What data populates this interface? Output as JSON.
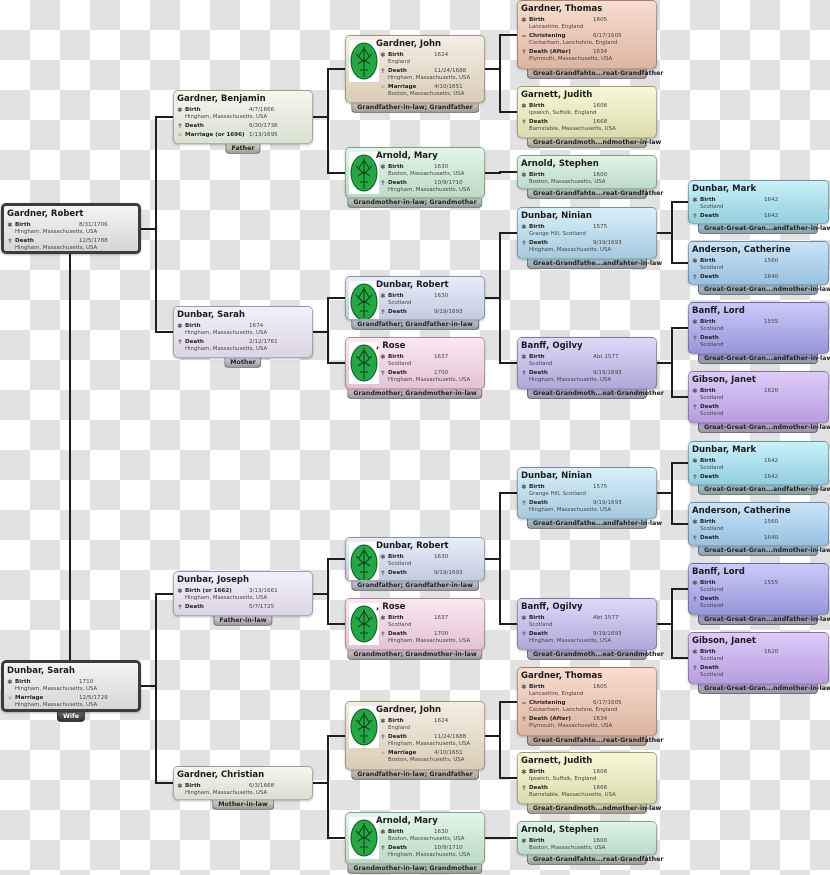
{
  "people": [
    {
      "name": "Gardner, Robert",
      "color": "#f4f4f4",
      "color2": "#d6d6d6",
      "relation": "",
      "events": [
        {
          "label": "Birth",
          "date": "8/31/1706",
          "place": "Hingham, Massachusetts, USA"
        },
        {
          "label": "Death",
          "date": "12/5/1788",
          "place": "Hingham, Massachusetts, USA"
        }
      ]
    },
    {
      "name": "Dunbar, Sarah",
      "color": "#f4f4f4",
      "color2": "#d6d6d6",
      "relation": "Wife",
      "events": [
        {
          "label": "Birth",
          "date": "1710",
          "place": "Hingham, Massachusetts, USA"
        },
        {
          "label": "Marriage",
          "date": "12/5/1729",
          "place": "Hingham, Massachusetts, USA"
        }
      ]
    },
    {
      "name": "Gardner, Benjamin",
      "color": "#f4f6ee",
      "color2": "#dbe1d0",
      "relation": "Father",
      "events": [
        {
          "label": "Birth",
          "date": "4/7/1666",
          "place": "Hingham, Massachusetts, USA"
        },
        {
          "label": "Death",
          "date": "6/30/1736",
          "place": ""
        },
        {
          "label": "Marriage (or 1696)",
          "date": "1/13/1695",
          "place": ""
        }
      ]
    },
    {
      "name": "Dunbar, Sarah",
      "color": "#f3effa",
      "color2": "#dcd5e6",
      "relation": "Mother",
      "events": [
        {
          "label": "Birth",
          "date": "1674",
          "place": "Hingham, Massachusetts, USA"
        },
        {
          "label": "Death",
          "date": "2/12/1761",
          "place": "Hingham, Massachusetts, USA"
        }
      ]
    },
    {
      "name": "Gardner, John",
      "photo": true,
      "color": "#f5eee2",
      "color2": "#dacdb8",
      "relation": "Grandfather-in-law; Grandfather",
      "events": [
        {
          "label": "Birth",
          "date": "1624",
          "place": "England"
        },
        {
          "label": "Death",
          "date": "11/24/1688",
          "place": "Hingham, Massachusetts, USA"
        },
        {
          "label": "Marriage",
          "date": "4/10/1651",
          "place": "Boston, Massachusetts, USA"
        }
      ]
    },
    {
      "name": "Arnold, Mary",
      "photo": true,
      "color": "#e3f6e8",
      "color2": "#bcdbc5",
      "relation": "Grandmother-in-law; Grandmother",
      "events": [
        {
          "label": "Birth",
          "date": "1630",
          "place": "Boston, Massachusetts, USA"
        },
        {
          "label": "Death",
          "date": "10/9/1710",
          "place": "Hingham, Massachusetts, USA"
        }
      ]
    },
    {
      "name": "Dunbar, Robert",
      "photo": true,
      "color": "#e8edf9",
      "color2": "#c3cbe0",
      "relation": "Grandfather; Grandfather-in-law",
      "events": [
        {
          "label": "Birth",
          "date": "1630",
          "place": "Scotland"
        },
        {
          "label": "Death",
          "date": "9/19/1693",
          "place": ""
        }
      ]
    },
    {
      "name": ", Rose",
      "photo": true,
      "color": "#fce8f3",
      "color2": "#e3c3d5",
      "relation": "Grandmother; Grandmother-in-law",
      "events": [
        {
          "label": "Birth",
          "date": "1637",
          "place": "Scotland"
        },
        {
          "label": "Death",
          "date": "1700",
          "place": "Hingham, Massachusetts, USA"
        }
      ]
    },
    {
      "name": "Gardner, Thomas",
      "color": "#f8ddd0",
      "color2": "#ddb5a2",
      "relation": "Great-Grandfahte...reat-Grandfather",
      "events": [
        {
          "label": "Birth",
          "date": "1605",
          "place": "Lancashire, England"
        },
        {
          "label": "Christening",
          "date": "6/17/1605",
          "place": "Cockerham, Lanchshire, England"
        },
        {
          "label": "Death (After)",
          "date": "1634",
          "place": "Plymouth, Massachusetts, USA"
        }
      ]
    },
    {
      "name": "Garnett, Judith",
      "color": "#f8f8d8",
      "color2": "#dcdcae",
      "relation": "Great-Grandmoth...ndmother-in-law",
      "events": [
        {
          "label": "Birth",
          "date": "1608",
          "place": "Ipswich, Suffolk, England"
        },
        {
          "label": "Death",
          "date": "1668",
          "place": "Barnstable, Massachusetts, USA"
        }
      ]
    },
    {
      "name": "Arnold, Stephen",
      "color": "#e0f5e8",
      "color2": "#bcdacb",
      "relation": "Great-Grandfahte...reat-Grandfather",
      "events": [
        {
          "label": "Birth",
          "date": "1600",
          "place": "Boston, Massachusetts, USA"
        }
      ]
    },
    {
      "name": "Dunbar, Ninian",
      "color": "#d9f0fb",
      "color2": "#a6cadd",
      "relation": "Great-Grandfathe...andfahter-in-law",
      "events": [
        {
          "label": "Birth",
          "date": "1575",
          "place": "Grange Hill, Scotland"
        },
        {
          "label": "Death",
          "date": "9/19/1693",
          "place": "Hingham, Massachusetts, USA"
        }
      ]
    },
    {
      "name": "Banff, Ogilvy",
      "color": "#ddd9f9",
      "color2": "#b0a9da",
      "relation": "Great-Grandmoth...eat-Grandmother",
      "events": [
        {
          "label": "Birth",
          "date": "Abt 1577",
          "place": "Scotland"
        },
        {
          "label": "Death",
          "date": "9/19/1693",
          "place": "Hingham, Massachusetts, USA"
        }
      ]
    },
    {
      "name": "Dunbar, Mark",
      "color": "#c9f1f9",
      "color2": "#92d0de",
      "relation": "Great-Great-Gran...andfather-in-law",
      "events": [
        {
          "label": "Birth",
          "date": "1642",
          "place": "Scotland"
        },
        {
          "label": "Death",
          "date": "1642",
          "place": ""
        }
      ]
    },
    {
      "name": "Anderson, Catherine",
      "color": "#cae4f9",
      "color2": "#99c1e0",
      "relation": "Great-Great-Gran...ndmother-in-law",
      "events": [
        {
          "label": "Birth",
          "date": "1560",
          "place": "Scotland"
        },
        {
          "label": "Death",
          "date": "1640",
          "place": ""
        }
      ]
    },
    {
      "name": "Banff, Lord",
      "color": "#cbcaf9",
      "color2": "#9896da",
      "relation": "Great-Great-Gran...andfather-in-law",
      "events": [
        {
          "label": "Birth",
          "date": "1555",
          "place": "Scotland"
        },
        {
          "label": "Death",
          "date": "",
          "place": "Scotland"
        }
      ]
    },
    {
      "name": "Gibson, Janet",
      "color": "#decbf9",
      "color2": "#b79ee0",
      "relation": "Great-Great-Gran...ndmother-in-law",
      "events": [
        {
          "label": "Birth",
          "date": "1620",
          "place": "Scotland"
        },
        {
          "label": "Death",
          "date": "",
          "place": "Scotland"
        }
      ]
    },
    {
      "name": "Dunbar, Joseph",
      "color": "#f3effa",
      "color2": "#dcd5e6",
      "relation": "Father-in-law",
      "events": [
        {
          "label": "Birth (or 1662)",
          "date": "3/13/1661",
          "place": "Hingham, Massachusetts, USA"
        },
        {
          "label": "Death",
          "date": "5/7/1725",
          "place": ""
        }
      ]
    },
    {
      "name": "Gardner, Christian",
      "color": "#f4f6ee",
      "color2": "#dbe1d0",
      "relation": "Mother-in-law",
      "events": [
        {
          "label": "Birth",
          "date": "6/3/1668",
          "place": "Hingham, Massachusetts, USA"
        }
      ]
    }
  ],
  "event_icons": {
    "Birth": "birth-star-icon",
    "Death": "death-cross-icon",
    "Marriage": "marriage-rings-icon",
    "Christening": "christening-icon"
  },
  "line_color": "#1e1e1e"
}
